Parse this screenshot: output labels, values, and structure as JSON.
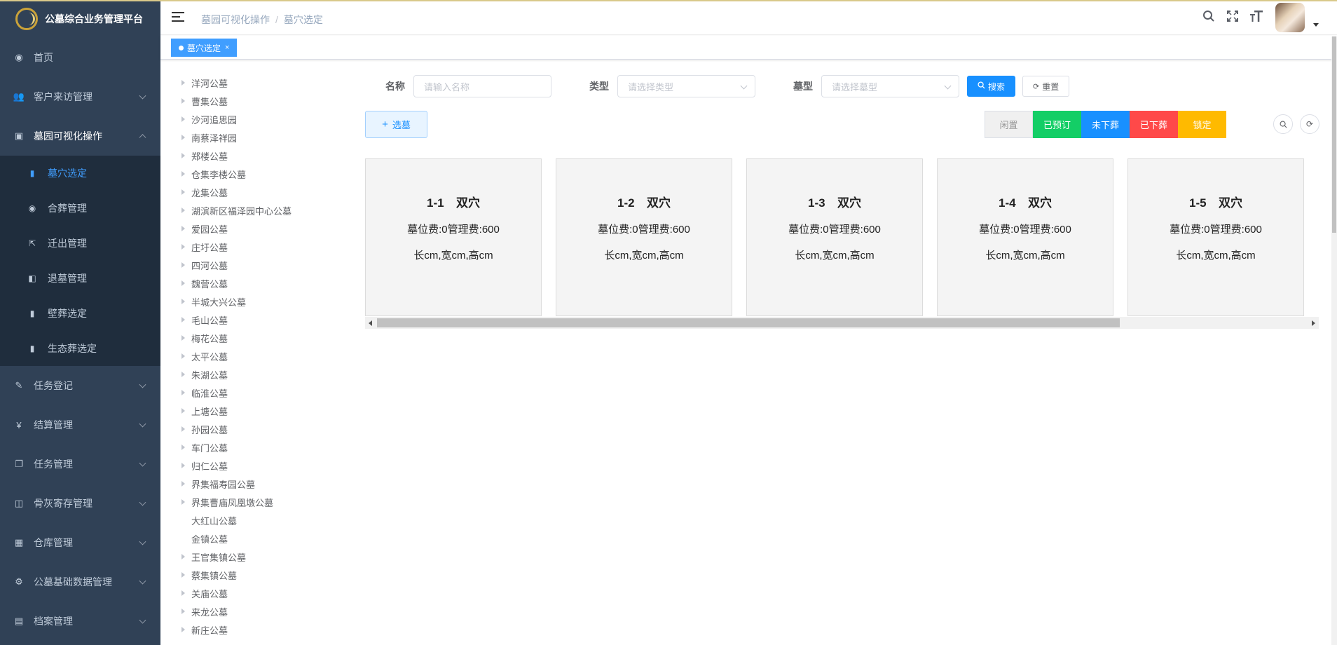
{
  "app": {
    "title": "公墓综合业务管理平台"
  },
  "sidebar": {
    "items": [
      {
        "label": "首页",
        "icon": "dashboard-icon",
        "glyph": "◉"
      },
      {
        "label": "客户来访管理",
        "icon": "user-icon",
        "glyph": "👥"
      },
      {
        "label": "墓园可视化操作",
        "icon": "monitor-icon",
        "glyph": "▣"
      }
    ],
    "subitems": [
      {
        "label": "墓穴选定",
        "glyph": "▮"
      },
      {
        "label": "合葬管理",
        "glyph": "◉"
      },
      {
        "label": "迁出管理",
        "glyph": "⇱"
      },
      {
        "label": "退墓管理",
        "glyph": "◧"
      },
      {
        "label": "壁葬选定",
        "glyph": "▮"
      },
      {
        "label": "生态葬选定",
        "glyph": "▮"
      }
    ],
    "items2": [
      {
        "label": "任务登记",
        "glyph": "✎"
      },
      {
        "label": "结算管理",
        "glyph": "¥"
      },
      {
        "label": "任务管理",
        "glyph": "❐"
      },
      {
        "label": "骨灰寄存管理",
        "glyph": "◫"
      },
      {
        "label": "仓库管理",
        "glyph": "▦"
      },
      {
        "label": "公墓基础数据管理",
        "glyph": "⚙"
      },
      {
        "label": "档案管理",
        "glyph": "▤"
      }
    ]
  },
  "header": {
    "breadcrumb": [
      "墓园可视化操作",
      "墓穴选定"
    ],
    "icons": [
      "search-icon",
      "fullscreen-icon",
      "font-size-icon"
    ]
  },
  "tags": {
    "active": "墓穴选定",
    "close": "×"
  },
  "tree": {
    "nodes": [
      {
        "label": "洋河公墓",
        "expand": true
      },
      {
        "label": "曹集公墓",
        "expand": true
      },
      {
        "label": "沙河追思园",
        "expand": true
      },
      {
        "label": "南蔡泽祥园",
        "expand": true
      },
      {
        "label": "郑楼公墓",
        "expand": true
      },
      {
        "label": "仓集李楼公墓",
        "expand": true
      },
      {
        "label": "龙集公墓",
        "expand": true
      },
      {
        "label": "湖滨新区福泽园中心公墓",
        "expand": true
      },
      {
        "label": "爱园公墓",
        "expand": true
      },
      {
        "label": "庄圩公墓",
        "expand": true
      },
      {
        "label": "四河公墓",
        "expand": true
      },
      {
        "label": "魏营公墓",
        "expand": true
      },
      {
        "label": "半城大兴公墓",
        "expand": true
      },
      {
        "label": "毛山公墓",
        "expand": true
      },
      {
        "label": "梅花公墓",
        "expand": true
      },
      {
        "label": "太平公墓",
        "expand": true
      },
      {
        "label": "朱湖公墓",
        "expand": true
      },
      {
        "label": "临淮公墓",
        "expand": true
      },
      {
        "label": "上塘公墓",
        "expand": true
      },
      {
        "label": "孙园公墓",
        "expand": true
      },
      {
        "label": "车门公墓",
        "expand": true
      },
      {
        "label": "归仁公墓",
        "expand": true
      },
      {
        "label": "界集福寿园公墓",
        "expand": true
      },
      {
        "label": "界集曹庙凤凰墩公墓",
        "expand": true
      },
      {
        "label": "大红山公墓",
        "expand": false
      },
      {
        "label": "金镇公墓",
        "expand": false
      },
      {
        "label": "王官集镇公墓",
        "expand": true
      },
      {
        "label": "蔡集镇公墓",
        "expand": true
      },
      {
        "label": "关庙公墓",
        "expand": true
      },
      {
        "label": "来龙公墓",
        "expand": true
      },
      {
        "label": "新庄公墓",
        "expand": true
      }
    ]
  },
  "search": {
    "name_label": "名称",
    "name_placeholder": "请输入名称",
    "type_label": "类型",
    "type_placeholder": "请选择类型",
    "tomb_label": "墓型",
    "tomb_placeholder": "请选择墓型",
    "search_btn": "搜索",
    "reset_btn": "重置"
  },
  "toolbar": {
    "add_btn": "选墓",
    "statuses": [
      {
        "label": "闲置",
        "bg": "#f0f0f0",
        "fg": "#999999"
      },
      {
        "label": "已预订",
        "bg": "#13ce66",
        "fg": "#ffffff"
      },
      {
        "label": "未下葬",
        "bg": "#1890ff",
        "fg": "#ffffff"
      },
      {
        "label": "已下葬",
        "bg": "#ff4949",
        "fg": "#ffffff"
      },
      {
        "label": "锁定",
        "bg": "#ffba00",
        "fg": "#ffffff"
      }
    ]
  },
  "cards": [
    {
      "code": "1-1",
      "type": "双穴",
      "fee": "墓位费:0管理费:600",
      "size": "长cm,宽cm,高cm"
    },
    {
      "code": "1-2",
      "type": "双穴",
      "fee": "墓位费:0管理费:600",
      "size": "长cm,宽cm,高cm"
    },
    {
      "code": "1-3",
      "type": "双穴",
      "fee": "墓位费:0管理费:600",
      "size": "长cm,宽cm,高cm"
    },
    {
      "code": "1-4",
      "type": "双穴",
      "fee": "墓位费:0管理费:600",
      "size": "长cm,宽cm,高cm"
    },
    {
      "code": "1-5",
      "type": "双穴",
      "fee": "墓位费:0管理费:600",
      "size": "长cm,宽cm,高cm"
    }
  ]
}
